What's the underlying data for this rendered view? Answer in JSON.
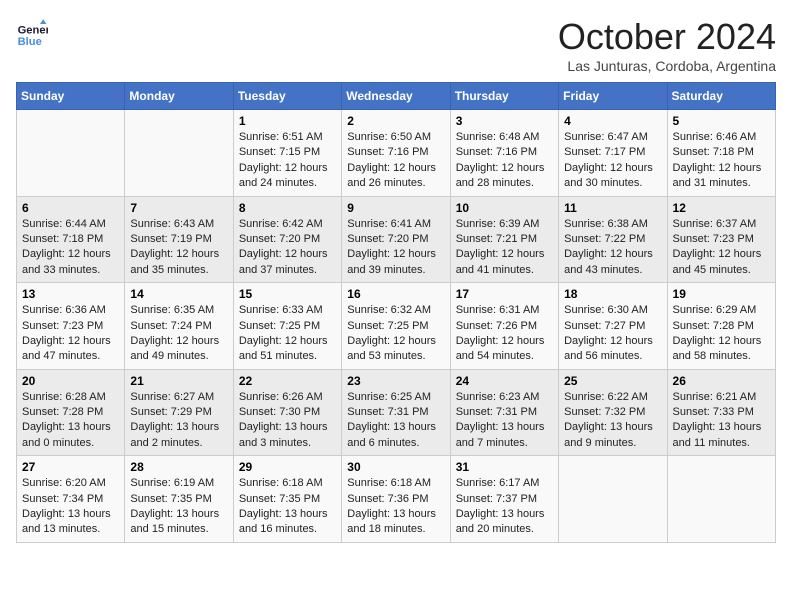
{
  "header": {
    "logo_line1": "General",
    "logo_line2": "Blue",
    "month_title": "October 2024",
    "location": "Las Junturas, Cordoba, Argentina"
  },
  "days_of_week": [
    "Sunday",
    "Monday",
    "Tuesday",
    "Wednesday",
    "Thursday",
    "Friday",
    "Saturday"
  ],
  "weeks": [
    [
      {
        "day": "",
        "sunrise": "",
        "sunset": "",
        "daylight": ""
      },
      {
        "day": "",
        "sunrise": "",
        "sunset": "",
        "daylight": ""
      },
      {
        "day": "1",
        "sunrise": "Sunrise: 6:51 AM",
        "sunset": "Sunset: 7:15 PM",
        "daylight": "Daylight: 12 hours and 24 minutes."
      },
      {
        "day": "2",
        "sunrise": "Sunrise: 6:50 AM",
        "sunset": "Sunset: 7:16 PM",
        "daylight": "Daylight: 12 hours and 26 minutes."
      },
      {
        "day": "3",
        "sunrise": "Sunrise: 6:48 AM",
        "sunset": "Sunset: 7:16 PM",
        "daylight": "Daylight: 12 hours and 28 minutes."
      },
      {
        "day": "4",
        "sunrise": "Sunrise: 6:47 AM",
        "sunset": "Sunset: 7:17 PM",
        "daylight": "Daylight: 12 hours and 30 minutes."
      },
      {
        "day": "5",
        "sunrise": "Sunrise: 6:46 AM",
        "sunset": "Sunset: 7:18 PM",
        "daylight": "Daylight: 12 hours and 31 minutes."
      }
    ],
    [
      {
        "day": "6",
        "sunrise": "Sunrise: 6:44 AM",
        "sunset": "Sunset: 7:18 PM",
        "daylight": "Daylight: 12 hours and 33 minutes."
      },
      {
        "day": "7",
        "sunrise": "Sunrise: 6:43 AM",
        "sunset": "Sunset: 7:19 PM",
        "daylight": "Daylight: 12 hours and 35 minutes."
      },
      {
        "day": "8",
        "sunrise": "Sunrise: 6:42 AM",
        "sunset": "Sunset: 7:20 PM",
        "daylight": "Daylight: 12 hours and 37 minutes."
      },
      {
        "day": "9",
        "sunrise": "Sunrise: 6:41 AM",
        "sunset": "Sunset: 7:20 PM",
        "daylight": "Daylight: 12 hours and 39 minutes."
      },
      {
        "day": "10",
        "sunrise": "Sunrise: 6:39 AM",
        "sunset": "Sunset: 7:21 PM",
        "daylight": "Daylight: 12 hours and 41 minutes."
      },
      {
        "day": "11",
        "sunrise": "Sunrise: 6:38 AM",
        "sunset": "Sunset: 7:22 PM",
        "daylight": "Daylight: 12 hours and 43 minutes."
      },
      {
        "day": "12",
        "sunrise": "Sunrise: 6:37 AM",
        "sunset": "Sunset: 7:23 PM",
        "daylight": "Daylight: 12 hours and 45 minutes."
      }
    ],
    [
      {
        "day": "13",
        "sunrise": "Sunrise: 6:36 AM",
        "sunset": "Sunset: 7:23 PM",
        "daylight": "Daylight: 12 hours and 47 minutes."
      },
      {
        "day": "14",
        "sunrise": "Sunrise: 6:35 AM",
        "sunset": "Sunset: 7:24 PM",
        "daylight": "Daylight: 12 hours and 49 minutes."
      },
      {
        "day": "15",
        "sunrise": "Sunrise: 6:33 AM",
        "sunset": "Sunset: 7:25 PM",
        "daylight": "Daylight: 12 hours and 51 minutes."
      },
      {
        "day": "16",
        "sunrise": "Sunrise: 6:32 AM",
        "sunset": "Sunset: 7:25 PM",
        "daylight": "Daylight: 12 hours and 53 minutes."
      },
      {
        "day": "17",
        "sunrise": "Sunrise: 6:31 AM",
        "sunset": "Sunset: 7:26 PM",
        "daylight": "Daylight: 12 hours and 54 minutes."
      },
      {
        "day": "18",
        "sunrise": "Sunrise: 6:30 AM",
        "sunset": "Sunset: 7:27 PM",
        "daylight": "Daylight: 12 hours and 56 minutes."
      },
      {
        "day": "19",
        "sunrise": "Sunrise: 6:29 AM",
        "sunset": "Sunset: 7:28 PM",
        "daylight": "Daylight: 12 hours and 58 minutes."
      }
    ],
    [
      {
        "day": "20",
        "sunrise": "Sunrise: 6:28 AM",
        "sunset": "Sunset: 7:28 PM",
        "daylight": "Daylight: 13 hours and 0 minutes."
      },
      {
        "day": "21",
        "sunrise": "Sunrise: 6:27 AM",
        "sunset": "Sunset: 7:29 PM",
        "daylight": "Daylight: 13 hours and 2 minutes."
      },
      {
        "day": "22",
        "sunrise": "Sunrise: 6:26 AM",
        "sunset": "Sunset: 7:30 PM",
        "daylight": "Daylight: 13 hours and 3 minutes."
      },
      {
        "day": "23",
        "sunrise": "Sunrise: 6:25 AM",
        "sunset": "Sunset: 7:31 PM",
        "daylight": "Daylight: 13 hours and 6 minutes."
      },
      {
        "day": "24",
        "sunrise": "Sunrise: 6:23 AM",
        "sunset": "Sunset: 7:31 PM",
        "daylight": "Daylight: 13 hours and 7 minutes."
      },
      {
        "day": "25",
        "sunrise": "Sunrise: 6:22 AM",
        "sunset": "Sunset: 7:32 PM",
        "daylight": "Daylight: 13 hours and 9 minutes."
      },
      {
        "day": "26",
        "sunrise": "Sunrise: 6:21 AM",
        "sunset": "Sunset: 7:33 PM",
        "daylight": "Daylight: 13 hours and 11 minutes."
      }
    ],
    [
      {
        "day": "27",
        "sunrise": "Sunrise: 6:20 AM",
        "sunset": "Sunset: 7:34 PM",
        "daylight": "Daylight: 13 hours and 13 minutes."
      },
      {
        "day": "28",
        "sunrise": "Sunrise: 6:19 AM",
        "sunset": "Sunset: 7:35 PM",
        "daylight": "Daylight: 13 hours and 15 minutes."
      },
      {
        "day": "29",
        "sunrise": "Sunrise: 6:18 AM",
        "sunset": "Sunset: 7:35 PM",
        "daylight": "Daylight: 13 hours and 16 minutes."
      },
      {
        "day": "30",
        "sunrise": "Sunrise: 6:18 AM",
        "sunset": "Sunset: 7:36 PM",
        "daylight": "Daylight: 13 hours and 18 minutes."
      },
      {
        "day": "31",
        "sunrise": "Sunrise: 6:17 AM",
        "sunset": "Sunset: 7:37 PM",
        "daylight": "Daylight: 13 hours and 20 minutes."
      },
      {
        "day": "",
        "sunrise": "",
        "sunset": "",
        "daylight": ""
      },
      {
        "day": "",
        "sunrise": "",
        "sunset": "",
        "daylight": ""
      }
    ]
  ]
}
